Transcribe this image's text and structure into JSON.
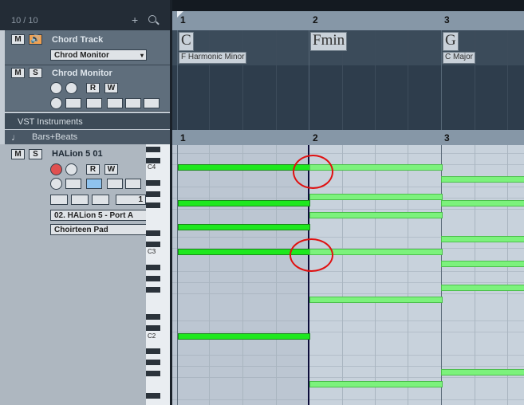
{
  "header": {
    "track_count": "10 / 10",
    "add": "+",
    "search_icon": "search-icon"
  },
  "chord_track": {
    "mute": "M",
    "name": "Chord Track",
    "monitor_select": "Chrod Monitor"
  },
  "chord_monitor_track": {
    "mute": "M",
    "solo": "S",
    "name": "Chrod Monitor",
    "read": "R",
    "write": "W"
  },
  "folders": {
    "vst_instruments": "VST Instruments",
    "bars_beats": "Bars+Beats"
  },
  "halion_track": {
    "mute": "M",
    "solo": "S",
    "name": "HALion 5 01",
    "read": "R",
    "write": "W",
    "channel": "1",
    "output": "02. HALion 5 - Port A",
    "program": "Choirteen Pad"
  },
  "ruler": {
    "bars": [
      "1",
      "2",
      "3"
    ]
  },
  "chords": [
    {
      "symbol": "C",
      "scale": "F Harmonic Minor"
    },
    {
      "symbol": "Fmin",
      "scale": ""
    },
    {
      "symbol": "G",
      "scale": "C Major"
    }
  ],
  "keys": [
    "C4",
    "C3",
    "C2"
  ],
  "colors": {
    "note_selected": "#1ee81e",
    "note_normal": "#7cf27c",
    "annotation": "#e01010"
  }
}
